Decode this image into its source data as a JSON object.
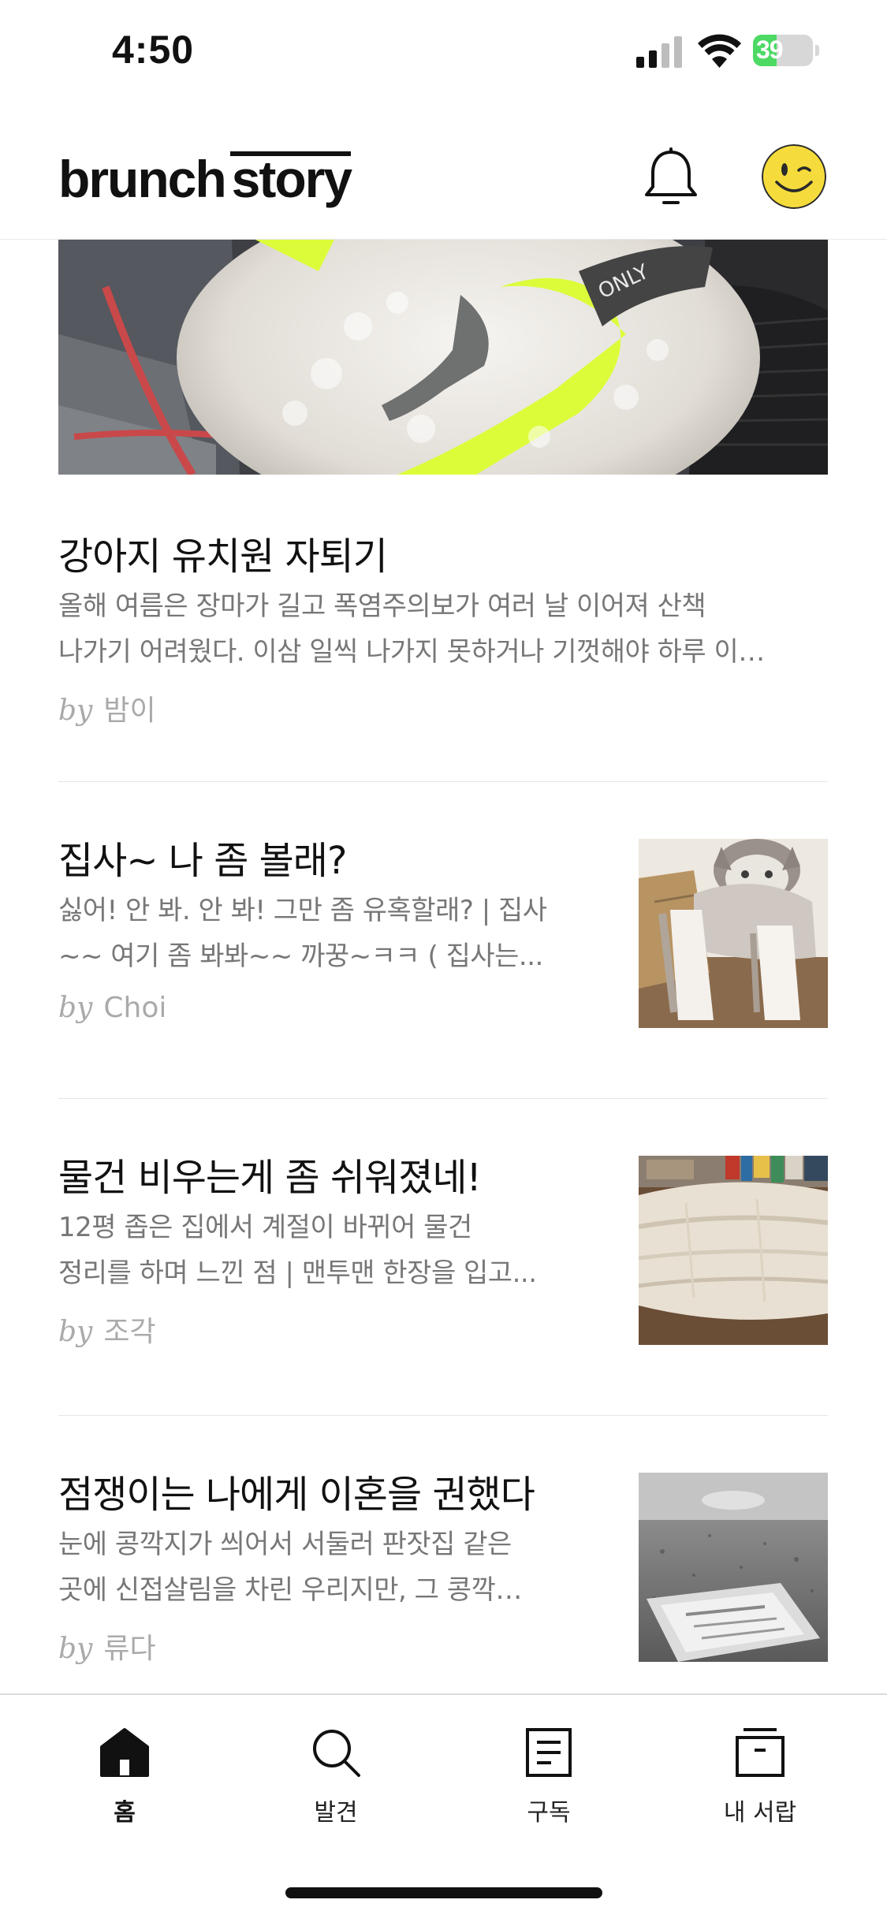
{
  "status_bar": {
    "time": "4:50",
    "battery": "39"
  },
  "header": {
    "logo_brunch": "brunch",
    "logo_story": "story"
  },
  "feed": {
    "articles": [
      {
        "title": "강아지 유치원 자퇴기",
        "excerpt_lines": [
          "올해 여름은 장마가 길고 폭염주의보가 여러 날 이어져 산책",
          "나가기 어려웠다. 이삼 일씩 나가지 못하거나 기껏해야 하루 이…"
        ],
        "by": "by",
        "author": "밤이"
      },
      {
        "title": "집사~ 나 좀 볼래?",
        "excerpt_lines": [
          "싫어! 안 봐. 안 봐! 그만 좀 유혹할래? | 집사",
          "~~ 여기 좀 봐봐~~  까꿍~ㅋㅋ  ( 집사는..."
        ],
        "by": "by",
        "author": "Choi"
      },
      {
        "title": "물건 비우는게 좀 쉬워졌네!",
        "excerpt_lines": [
          "12평 좁은 집에서 계절이 바뀌어 물건",
          "정리를 하며 느낀 점 | 맨투맨 한장을 입고..."
        ],
        "by": "by",
        "author": "조각"
      },
      {
        "title": "점쟁이는 나에게 이혼을 권했다",
        "excerpt_lines": [
          "눈에 콩깍지가 씌어서 서둘러 판잣집 같은",
          "곳에 신접살림을 차린 우리지만, 그 콩깍…"
        ],
        "by": "by",
        "author": "류다"
      }
    ]
  },
  "tab_bar": {
    "tabs": [
      {
        "label": "홈",
        "icon": "home-icon",
        "active": true
      },
      {
        "label": "발견",
        "icon": "search-icon",
        "active": false
      },
      {
        "label": "구독",
        "icon": "document-icon",
        "active": false
      },
      {
        "label": "내 서랍",
        "icon": "drawer-icon",
        "active": false
      }
    ]
  },
  "colors": {
    "battery_fill": "#4cd964",
    "text_primary": "#111111",
    "text_secondary": "#777777",
    "author_text": "#aaaaaa",
    "avatar_yellow": "#f5dc3c"
  }
}
